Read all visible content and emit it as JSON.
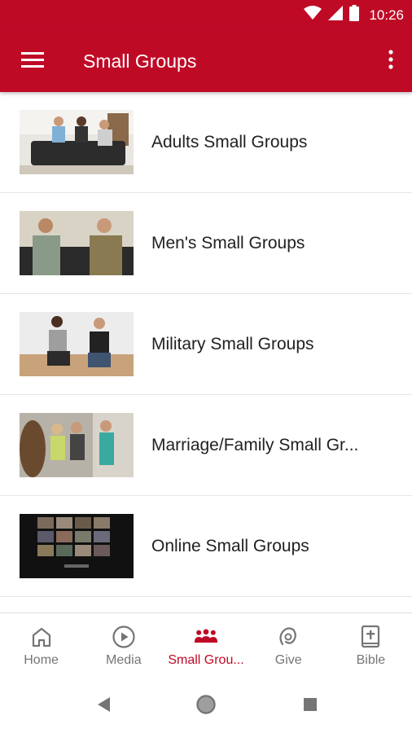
{
  "status_bar": {
    "time": "10:26",
    "icons": [
      "wifi-icon",
      "cellular-signal-icon",
      "battery-icon"
    ]
  },
  "app_bar": {
    "title": "Small Groups",
    "menu_icon": "hamburger-menu-icon",
    "more_icon": "more-vert-icon"
  },
  "colors": {
    "brand": "#bf0a26",
    "text": "#212121",
    "muted": "#757575"
  },
  "groups": [
    {
      "label": "Adults Small Groups"
    },
    {
      "label": "Men's Small Groups"
    },
    {
      "label": "Military Small Groups"
    },
    {
      "label": "Marriage/Family Small Gr..."
    },
    {
      "label": "Online Small Groups"
    }
  ],
  "bottom_nav": [
    {
      "label": "Home",
      "icon": "home-icon",
      "active": false
    },
    {
      "label": "Media",
      "icon": "play-circle-icon",
      "active": false
    },
    {
      "label": "Small Grou...",
      "icon": "groups-icon",
      "active": true
    },
    {
      "label": "Give",
      "icon": "give-icon",
      "active": false
    },
    {
      "label": "Bible",
      "icon": "bible-icon",
      "active": false
    }
  ],
  "system_nav": [
    "back-icon",
    "home-circle-icon",
    "recents-icon"
  ]
}
